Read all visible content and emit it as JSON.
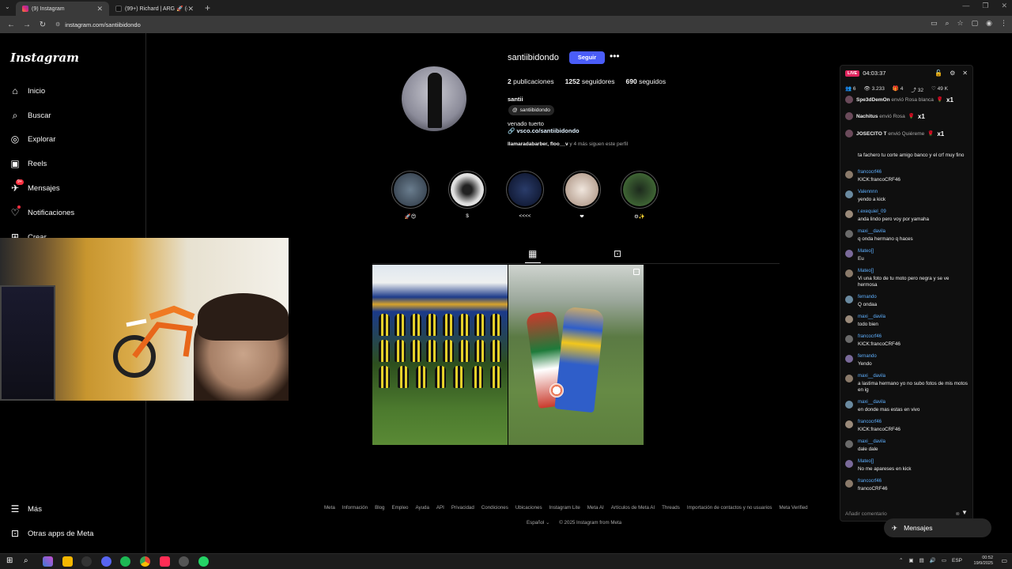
{
  "browser": {
    "tabs": [
      {
        "title": "(9) Instagram",
        "active": true
      },
      {
        "title": "(99+) Richard | ARG 🚀 (@rgiao...",
        "active": false
      }
    ],
    "url": "instagram.com/santiibidondo"
  },
  "sidebar": {
    "logo": "Instagram",
    "items": [
      {
        "label": "Inicio"
      },
      {
        "label": "Buscar"
      },
      {
        "label": "Explorar"
      },
      {
        "label": "Reels"
      },
      {
        "label": "Mensajes",
        "badge": "9+"
      },
      {
        "label": "Notificaciones"
      },
      {
        "label": "Crear"
      },
      {
        "label": "Más"
      },
      {
        "label": "Otras apps de Meta"
      }
    ]
  },
  "profile": {
    "username": "santiibidondo",
    "follow_label": "Seguir",
    "posts_count": "2",
    "posts_label": "publicaciones",
    "followers_count": "1252",
    "followers_label": "seguidores",
    "following_count": "690",
    "following_label": "seguidos",
    "full_name": "santii",
    "threads_handle": "santiibidondo",
    "bio": "venado tuerto",
    "link": "vsco.co/santiibidondo",
    "followed_by_names": "llamaradabarber, floo__v",
    "followed_by_rest": " y 4 más siguen este perfil"
  },
  "highlights": [
    {
      "label": "🚀😍",
      "color": "#3d4b5a"
    },
    {
      "label": "$",
      "color": "#c9c9c9"
    },
    {
      "label": "<<<<",
      "color": "#0f1a35"
    },
    {
      "label": "❤",
      "color": "#d6c9c0"
    },
    {
      "label": "⚙✨",
      "color": "#3e6b3a"
    }
  ],
  "footer": {
    "links": [
      "Meta",
      "Información",
      "Blog",
      "Empleo",
      "Ayuda",
      "API",
      "Privacidad",
      "Condiciones",
      "Ubicaciones",
      "Instagram Lite",
      "Meta AI",
      "Artículos de Meta AI",
      "Threads",
      "Importación de contactos y no usuarios",
      "Meta Verified"
    ],
    "language": "Español",
    "copyright": "© 2025 Instagram from Meta"
  },
  "chat": {
    "live": "LIVE",
    "timer": "04:03:37",
    "stats": [
      "6",
      "3.233",
      "4",
      "32",
      "49 K"
    ],
    "gifts": [
      {
        "user": "Spe3dDemOn",
        "action": " envió Rosa blanca",
        "mult": "x1"
      },
      {
        "user": "Nachitus",
        "action": " envió Rosa",
        "mult": "x1"
      },
      {
        "user": "JOSECITO T",
        "action": " envió Quiéreme",
        "mult": "x1"
      }
    ],
    "messages": [
      {
        "name": "",
        "text": "ta fachero tu corte amigo banco y el crf muy fino"
      },
      {
        "name": "francocrf46",
        "text": "KICK:francoCRF46"
      },
      {
        "name": "Valennnn",
        "text": "yendo a kick"
      },
      {
        "name": "r.exequiel_09",
        "text": "anda lindo pero voy por yamaha"
      },
      {
        "name": "maxi__davila",
        "text": "q onda hermano q haces"
      },
      {
        "name": "Mateo[]",
        "text": "Eu"
      },
      {
        "name": "Mateo[]",
        "text": "Vi una foto de tu moto pero negra y se ve hermosa"
      },
      {
        "name": "fernando",
        "text": "Q ondaa"
      },
      {
        "name": "maxi__davila",
        "text": "todo bien"
      },
      {
        "name": "francocrf46",
        "text": "KICK:francoCRF46"
      },
      {
        "name": "fernando",
        "text": "Yendo"
      },
      {
        "name": "maxi__davila",
        "text": "a lastima hermano yo no subo fotos de mis motos en ig"
      },
      {
        "name": "maxi__davila",
        "text": "en donde mas estas en vivo"
      },
      {
        "name": "francocrf46",
        "text": "KICK:francoCRF46"
      },
      {
        "name": "maxi__davila",
        "text": "dale dale"
      },
      {
        "name": "Mateo[]",
        "text": "No me apareses en kick"
      },
      {
        "name": "francocrf46",
        "text": "francoCRF46"
      }
    ],
    "input_placeholder": "Añadir comentario"
  },
  "messages_pill": "Mensajes",
  "taskbar": {
    "lang": "ESP",
    "time": "00:52",
    "date": "19/9/2025"
  }
}
